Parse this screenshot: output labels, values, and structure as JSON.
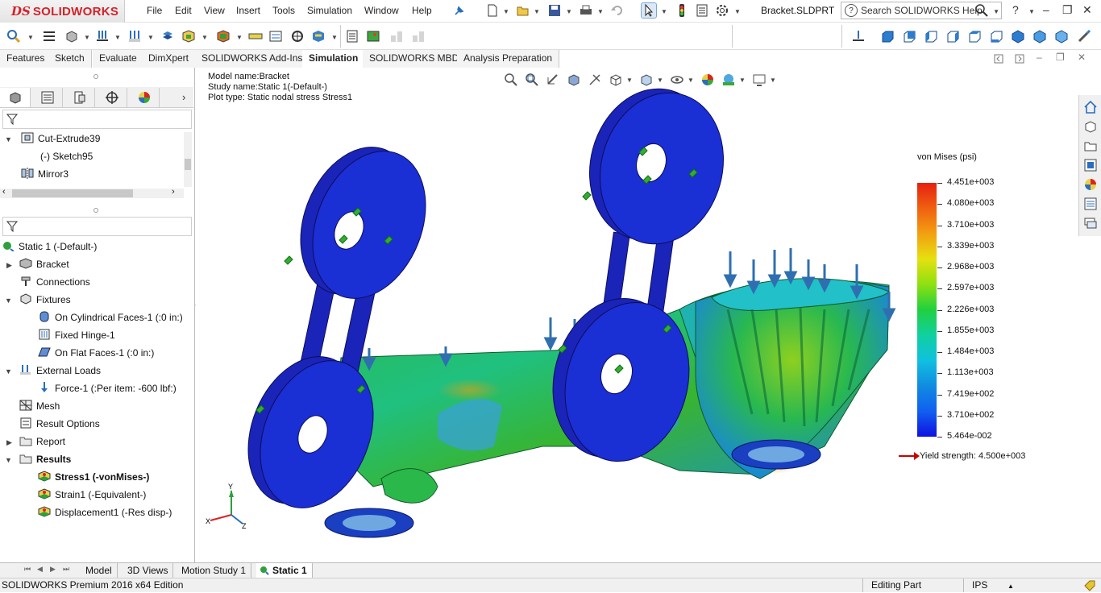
{
  "app": {
    "logo_mark": "DS",
    "logo_name": "SOLIDWORKS",
    "menu": [
      "File",
      "Edit",
      "View",
      "Insert",
      "Tools",
      "Simulation",
      "Window",
      "Help"
    ],
    "document_title": "Bracket.SLDPRT",
    "search_placeholder": "Search SOLIDWORKS Help",
    "help_label": "?"
  },
  "command_tabs": [
    {
      "label": "Features",
      "active": false
    },
    {
      "label": "Sketch",
      "active": false
    },
    {
      "label": "Evaluate",
      "active": false
    },
    {
      "label": "DimXpert",
      "active": false
    },
    {
      "label": "SOLIDWORKS Add-Ins",
      "active": false
    },
    {
      "label": "Simulation",
      "active": true
    },
    {
      "label": "SOLIDWORKS MBD",
      "active": false
    },
    {
      "label": "Analysis Preparation",
      "active": false
    }
  ],
  "feature_tree": {
    "items": [
      {
        "label": "Cut-Extrude39",
        "icon": "cut-extrude-icon"
      },
      {
        "label": "(-) Sketch95",
        "icon": "sketch-icon"
      },
      {
        "label": "Mirror3",
        "icon": "mirror-icon"
      }
    ]
  },
  "sim_tree": {
    "study": "Static 1 (-Default-)",
    "items": [
      {
        "label": "Bracket",
        "bold": false
      },
      {
        "label": "Connections",
        "bold": false
      },
      {
        "label": "Fixtures",
        "bold": false
      },
      {
        "label": "On Cylindrical Faces-1 (:0 in:)",
        "bold": false
      },
      {
        "label": "Fixed Hinge-1",
        "bold": false
      },
      {
        "label": "On Flat Faces-1 (:0 in:)",
        "bold": false
      },
      {
        "label": "External Loads",
        "bold": false
      },
      {
        "label": "Force-1 (:Per item: -600 lbf:)",
        "bold": false
      },
      {
        "label": "Mesh",
        "bold": false
      },
      {
        "label": "Result Options",
        "bold": false
      },
      {
        "label": "Report",
        "bold": false
      },
      {
        "label": "Results",
        "bold": true
      },
      {
        "label": "Stress1 (-vonMises-)",
        "bold": true
      },
      {
        "label": "Strain1 (-Equivalent-)",
        "bold": false
      },
      {
        "label": "Displacement1 (-Res disp-)",
        "bold": false
      }
    ]
  },
  "viewport": {
    "model_name": "Model name:Bracket",
    "study_name": "Study name:Static 1(-Default-)",
    "plot_type": "Plot type: Static nodal stress Stress1"
  },
  "legend": {
    "title": "von Mises (psi)",
    "values": [
      "4.451e+003",
      "4.080e+003",
      "3.710e+003",
      "3.339e+003",
      "2.968e+003",
      "2.597e+003",
      "2.226e+003",
      "1.855e+003",
      "1.484e+003",
      "1.113e+003",
      "7.419e+002",
      "3.710e+002",
      "5.464e-002"
    ],
    "yield_label": "Yield strength: 4.500e+003"
  },
  "axis_triad": {
    "x": "X",
    "y": "Y",
    "z": "Z"
  },
  "bottom_tabs": [
    {
      "label": "Model",
      "active": false
    },
    {
      "label": "3D Views",
      "active": false
    },
    {
      "label": "Motion Study 1",
      "active": false
    },
    {
      "label": "Static 1",
      "active": true
    }
  ],
  "status": {
    "edition": "SOLIDWORKS Premium 2016 x64 Edition",
    "mode": "Editing Part",
    "units": "IPS"
  },
  "colors": {
    "brand": "#d2232a",
    "model_blue": "#1a24b8",
    "load_arrow": "#2f6fb0",
    "fixture_green": "#30b030"
  }
}
